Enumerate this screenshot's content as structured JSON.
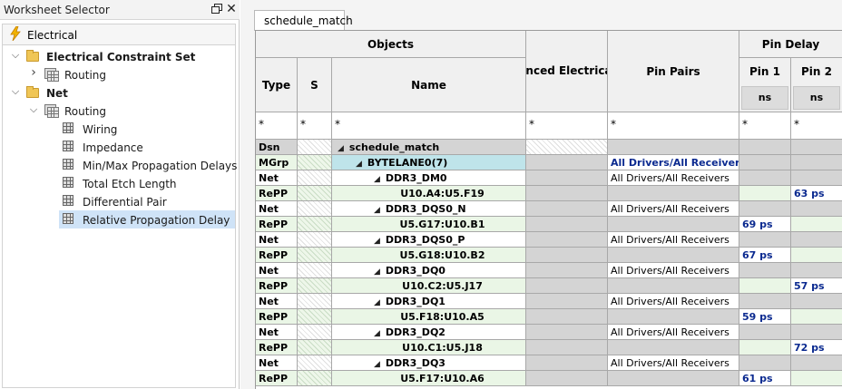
{
  "left_panel": {
    "title": "Worksheet Selector",
    "close_glyph": "✕",
    "selector_label": "Electrical",
    "tree": [
      {
        "label": "Electrical Constraint Set",
        "bold": true,
        "level": 0,
        "expanded": true,
        "icon": "folder-icon"
      },
      {
        "label": "Routing",
        "bold": false,
        "level": 1,
        "expanded": false,
        "icon": "worksheet-group-icon"
      },
      {
        "label": "Net",
        "bold": true,
        "level": 0,
        "expanded": true,
        "icon": "folder-icon"
      },
      {
        "label": "Routing",
        "bold": false,
        "level": 1,
        "expanded": true,
        "icon": "worksheet-group-icon"
      },
      {
        "label": "Wiring",
        "bold": false,
        "level": 2,
        "icon": "worksheet-icon"
      },
      {
        "label": "Impedance",
        "bold": false,
        "level": 2,
        "icon": "worksheet-icon"
      },
      {
        "label": "Min/Max Propagation Delays",
        "bold": false,
        "level": 2,
        "icon": "worksheet-icon"
      },
      {
        "label": "Total Etch Length",
        "bold": false,
        "level": 2,
        "icon": "worksheet-icon"
      },
      {
        "label": "Differential Pair",
        "bold": false,
        "level": 2,
        "icon": "worksheet-icon"
      },
      {
        "label": "Relative Propagation Delay",
        "bold": false,
        "level": 2,
        "icon": "worksheet-icon",
        "selected": true
      }
    ]
  },
  "worksheet": {
    "tab_label": "schedule_match",
    "headers": {
      "objects": "Objects",
      "type": "Type",
      "s": "S",
      "name": "Name",
      "referenced_cset": "Referenced Electrical CSet",
      "pin_pairs": "Pin Pairs",
      "pin_delay": "Pin Delay",
      "pin1": "Pin 1",
      "pin2": "Pin 2",
      "pin1_unit": "ns",
      "pin2_unit": "ns"
    },
    "filter_value": "*",
    "rows": [
      {
        "type": "Dsn",
        "name": "schedule_match",
        "indent": 0,
        "expander": true,
        "pin_pairs": "",
        "pin1": "",
        "pin2": "",
        "kind": "dsn"
      },
      {
        "type": "MGrp",
        "name": "BYTELANE0(7)",
        "indent": 1,
        "expander": true,
        "pin_pairs": "All Drivers/All Receivers",
        "pin1": "",
        "pin2": "",
        "kind": "mgrp"
      },
      {
        "type": "Net",
        "name": "DDR3_DM0",
        "indent": 2,
        "expander": true,
        "pin_pairs": "All Drivers/All Receivers",
        "pin1": "",
        "pin2": "",
        "kind": "net"
      },
      {
        "type": "RePP",
        "name": "U10.A4:U5.F19",
        "indent": 3,
        "expander": false,
        "pin_pairs": "",
        "pin1": "",
        "pin2": "63 ps",
        "kind": "repp"
      },
      {
        "type": "Net",
        "name": "DDR3_DQS0_N",
        "indent": 2,
        "expander": true,
        "pin_pairs": "All Drivers/All Receivers",
        "pin1": "",
        "pin2": "",
        "kind": "net"
      },
      {
        "type": "RePP",
        "name": "U5.G17:U10.B1",
        "indent": 3,
        "expander": false,
        "pin_pairs": "",
        "pin1": "69 ps",
        "pin2": "",
        "kind": "repp"
      },
      {
        "type": "Net",
        "name": "DDR3_DQS0_P",
        "indent": 2,
        "expander": true,
        "pin_pairs": "All Drivers/All Receivers",
        "pin1": "",
        "pin2": "",
        "kind": "net"
      },
      {
        "type": "RePP",
        "name": "U5.G18:U10.B2",
        "indent": 3,
        "expander": false,
        "pin_pairs": "",
        "pin1": "67 ps",
        "pin2": "",
        "kind": "repp"
      },
      {
        "type": "Net",
        "name": "DDR3_DQ0",
        "indent": 2,
        "expander": true,
        "pin_pairs": "All Drivers/All Receivers",
        "pin1": "",
        "pin2": "",
        "kind": "net"
      },
      {
        "type": "RePP",
        "name": "U10.C2:U5.J17",
        "indent": 3,
        "expander": false,
        "pin_pairs": "",
        "pin1": "",
        "pin2": "57 ps",
        "kind": "repp"
      },
      {
        "type": "Net",
        "name": "DDR3_DQ1",
        "indent": 2,
        "expander": true,
        "pin_pairs": "All Drivers/All Receivers",
        "pin1": "",
        "pin2": "",
        "kind": "net"
      },
      {
        "type": "RePP",
        "name": "U5.F18:U10.A5",
        "indent": 3,
        "expander": false,
        "pin_pairs": "",
        "pin1": "59 ps",
        "pin2": "",
        "kind": "repp"
      },
      {
        "type": "Net",
        "name": "DDR3_DQ2",
        "indent": 2,
        "expander": true,
        "pin_pairs": "All Drivers/All Receivers",
        "pin1": "",
        "pin2": "",
        "kind": "net"
      },
      {
        "type": "RePP",
        "name": "U10.C1:U5.J18",
        "indent": 3,
        "expander": false,
        "pin_pairs": "",
        "pin1": "",
        "pin2": "72 ps",
        "kind": "repp"
      },
      {
        "type": "Net",
        "name": "DDR3_DQ3",
        "indent": 2,
        "expander": true,
        "pin_pairs": "All Drivers/All Receivers",
        "pin1": "",
        "pin2": "",
        "kind": "net"
      },
      {
        "type": "RePP",
        "name": "U5.F17:U10.A6",
        "indent": 3,
        "expander": false,
        "pin_pairs": "",
        "pin1": "61 ps",
        "pin2": "",
        "kind": "repp"
      }
    ]
  }
}
